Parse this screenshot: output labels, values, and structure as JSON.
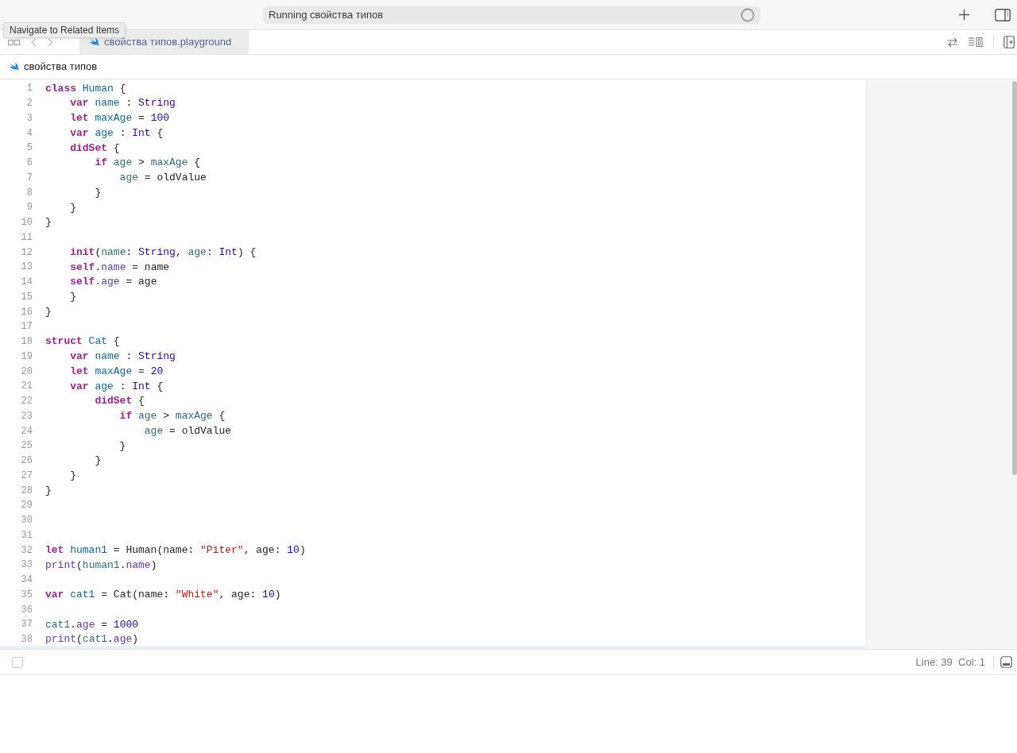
{
  "toolbar": {
    "activity": "Running свойства типов"
  },
  "tooltip": "Navigate to Related Items",
  "tabs": [
    {
      "label": "свойства типов.playground",
      "selected": true
    }
  ],
  "breadcrumb": "свойства типов",
  "code_lines": [
    {
      "number": "1",
      "tokens": [
        {
          "text": "class",
          "kind": "keyword"
        },
        {
          "text": " Human",
          "kind": "decl"
        },
        {
          "text": " {",
          "kind": "plain"
        }
      ]
    },
    {
      "number": "2",
      "tokens": [
        {
          "text": "    var",
          "kind": "keyword"
        },
        {
          "text": " name",
          "kind": "decl"
        },
        {
          "text": " :",
          "kind": "plain"
        },
        {
          "text": " String",
          "kind": "type"
        }
      ]
    },
    {
      "number": "3",
      "tokens": [
        {
          "text": "    let",
          "kind": "keyword"
        },
        {
          "text": " maxAge",
          "kind": "decl"
        },
        {
          "text": " =",
          "kind": "plain"
        },
        {
          "text": " 100",
          "kind": "number"
        }
      ]
    },
    {
      "number": "4",
      "tokens": [
        {
          "text": "    var",
          "kind": "keyword"
        },
        {
          "text": " age",
          "kind": "decl"
        },
        {
          "text": " :",
          "kind": "plain"
        },
        {
          "text": " Int",
          "kind": "type"
        },
        {
          "text": " {",
          "kind": "plain"
        }
      ]
    },
    {
      "number": "5",
      "tokens": [
        {
          "text": "    didSet",
          "kind": "keyword"
        },
        {
          "text": " {",
          "kind": "plain"
        }
      ]
    },
    {
      "number": "6",
      "tokens": [
        {
          "text": "        if",
          "kind": "keyword"
        },
        {
          "text": " age",
          "kind": "variable"
        },
        {
          "text": " >",
          "kind": "plain"
        },
        {
          "text": " maxAge",
          "kind": "variable"
        },
        {
          "text": " {",
          "kind": "plain"
        }
      ]
    },
    {
      "number": "7",
      "tokens": [
        {
          "text": "            age",
          "kind": "variable"
        },
        {
          "text": " = oldValue",
          "kind": "plain"
        }
      ]
    },
    {
      "number": "8",
      "tokens": [
        {
          "text": "        }",
          "kind": "plain"
        }
      ]
    },
    {
      "number": "9",
      "tokens": [
        {
          "text": "    }",
          "kind": "plain"
        }
      ]
    },
    {
      "number": "10",
      "tokens": [
        {
          "text": "}",
          "kind": "plain"
        }
      ]
    },
    {
      "number": "11"
    },
    {
      "number": "12",
      "tokens": [
        {
          "text": "    init",
          "kind": "keyword"
        },
        {
          "text": "(",
          "kind": "plain"
        },
        {
          "text": "name",
          "kind": "variable"
        },
        {
          "text": ":",
          "kind": "plain"
        },
        {
          "text": " String",
          "kind": "type"
        },
        {
          "text": ",",
          "kind": "plain"
        },
        {
          "text": " age",
          "kind": "variable"
        },
        {
          "text": ":",
          "kind": "plain"
        },
        {
          "text": " Int",
          "kind": "type"
        },
        {
          "text": ") {",
          "kind": "plain"
        }
      ]
    },
    {
      "number": "13",
      "tokens": [
        {
          "text": "    self",
          "kind": "keyword"
        },
        {
          "text": ".",
          "kind": "plain"
        },
        {
          "text": "name",
          "kind": "member"
        },
        {
          "text": " = name",
          "kind": "plain"
        }
      ]
    },
    {
      "number": "14",
      "tokens": [
        {
          "text": "    self",
          "kind": "keyword"
        },
        {
          "text": ".",
          "kind": "plain"
        },
        {
          "text": "age",
          "kind": "member"
        },
        {
          "text": " = age",
          "kind": "plain"
        }
      ]
    },
    {
      "number": "15",
      "tokens": [
        {
          "text": "    }",
          "kind": "plain"
        }
      ]
    },
    {
      "number": "16",
      "tokens": [
        {
          "text": "}",
          "kind": "plain"
        }
      ]
    },
    {
      "number": "17"
    },
    {
      "number": "18",
      "tokens": [
        {
          "text": "struct",
          "kind": "keyword"
        },
        {
          "text": " Cat",
          "kind": "decl"
        },
        {
          "text": " {",
          "kind": "plain"
        }
      ]
    },
    {
      "number": "19",
      "tokens": [
        {
          "text": "    var",
          "kind": "keyword"
        },
        {
          "text": " name",
          "kind": "decl"
        },
        {
          "text": " :",
          "kind": "plain"
        },
        {
          "text": " String",
          "kind": "type"
        }
      ]
    },
    {
      "number": "20",
      "tokens": [
        {
          "text": "    let",
          "kind": "keyword"
        },
        {
          "text": " maxAge",
          "kind": "decl"
        },
        {
          "text": " =",
          "kind": "plain"
        },
        {
          "text": " 20",
          "kind": "number"
        }
      ]
    },
    {
      "number": "21",
      "tokens": [
        {
          "text": "    var",
          "kind": "keyword"
        },
        {
          "text": " age",
          "kind": "decl"
        },
        {
          "text": " :",
          "kind": "plain"
        },
        {
          "text": " Int",
          "kind": "type"
        },
        {
          "text": " {",
          "kind": "plain"
        }
      ]
    },
    {
      "number": "22",
      "tokens": [
        {
          "text": "        didSet",
          "kind": "keyword"
        },
        {
          "text": " {",
          "kind": "plain"
        }
      ]
    },
    {
      "number": "23",
      "tokens": [
        {
          "text": "            if",
          "kind": "keyword"
        },
        {
          "text": " age",
          "kind": "variable"
        },
        {
          "text": " >",
          "kind": "plain"
        },
        {
          "text": " maxAge",
          "kind": "variable"
        },
        {
          "text": " {",
          "kind": "plain"
        }
      ]
    },
    {
      "number": "24",
      "tokens": [
        {
          "text": "                age",
          "kind": "variable"
        },
        {
          "text": " = oldValue",
          "kind": "plain"
        }
      ]
    },
    {
      "number": "25",
      "tokens": [
        {
          "text": "            }",
          "kind": "plain"
        }
      ]
    },
    {
      "number": "26",
      "tokens": [
        {
          "text": "        }",
          "kind": "plain"
        }
      ]
    },
    {
      "number": "27",
      "tokens": [
        {
          "text": "    }",
          "kind": "plain"
        }
      ]
    },
    {
      "number": "28",
      "tokens": [
        {
          "text": "}",
          "kind": "plain"
        }
      ]
    },
    {
      "number": "29"
    },
    {
      "number": "30"
    },
    {
      "number": "31"
    },
    {
      "number": "32",
      "tokens": [
        {
          "text": "let",
          "kind": "keyword"
        },
        {
          "text": " human1",
          "kind": "decl"
        },
        {
          "text": " = Human(name:",
          "kind": "plain"
        },
        {
          "text": " \"Piter\"",
          "kind": "string"
        },
        {
          "text": ", age:",
          "kind": "plain"
        },
        {
          "text": " 10",
          "kind": "number"
        },
        {
          "text": ")",
          "kind": "plain"
        }
      ]
    },
    {
      "number": "33",
      "tokens": [
        {
          "text": "print",
          "kind": "member"
        },
        {
          "text": "(",
          "kind": "plain"
        },
        {
          "text": "human1",
          "kind": "variable"
        },
        {
          "text": ".",
          "kind": "plain"
        },
        {
          "text": "name",
          "kind": "member"
        },
        {
          "text": ")",
          "kind": "plain"
        }
      ]
    },
    {
      "number": "34"
    },
    {
      "number": "35",
      "tokens": [
        {
          "text": "var",
          "kind": "keyword"
        },
        {
          "text": " cat1",
          "kind": "decl"
        },
        {
          "text": " = Cat(name:",
          "kind": "plain"
        },
        {
          "text": " \"White\"",
          "kind": "string"
        },
        {
          "text": ", age:",
          "kind": "plain"
        },
        {
          "text": " 10",
          "kind": "number"
        },
        {
          "text": ")",
          "kind": "plain"
        }
      ]
    },
    {
      "number": "36"
    },
    {
      "number": "37",
      "tokens": [
        {
          "text": "cat1",
          "kind": "variable"
        },
        {
          "text": ".",
          "kind": "plain"
        },
        {
          "text": "age",
          "kind": "member"
        },
        {
          "text": " =",
          "kind": "plain"
        },
        {
          "text": " 1000",
          "kind": "number"
        }
      ]
    },
    {
      "number": "38",
      "tokens": [
        {
          "text": "print",
          "kind": "member"
        },
        {
          "text": "(",
          "kind": "plain"
        },
        {
          "text": "cat1",
          "kind": "variable"
        },
        {
          "text": ".",
          "kind": "plain"
        },
        {
          "text": "age",
          "kind": "member"
        },
        {
          "text": ")",
          "kind": "plain"
        }
      ]
    }
  ],
  "status": {
    "checked": false,
    "position": "Line: 39  Col: 1"
  }
}
